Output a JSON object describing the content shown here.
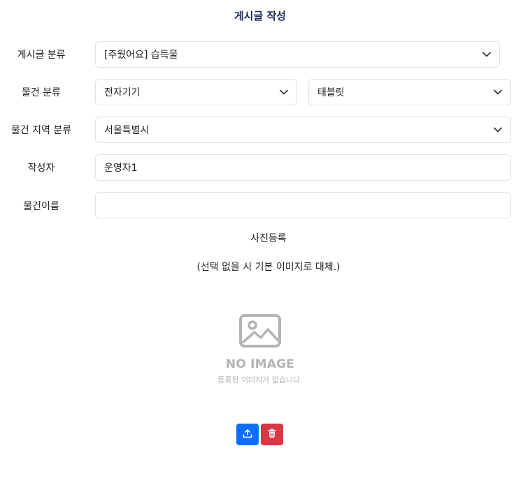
{
  "page": {
    "title": "게시글 작성"
  },
  "form": {
    "category": {
      "label": "게시글 분류",
      "value": "[주웠어요] 습득물"
    },
    "item_category": {
      "label": "물건 분류",
      "value": "전자기기",
      "sub_value": "태블릿"
    },
    "region": {
      "label": "물건 지역 분류",
      "value": "서울특별시"
    },
    "author": {
      "label": "작성자",
      "value": "운영자1"
    },
    "item_name": {
      "label": "물건이름",
      "value": "",
      "placeholder": ""
    }
  },
  "photo": {
    "heading": "사진등록",
    "note": "(선택 없을 시 기본 이미지로 대체.)",
    "no_image_title": "NO IMAGE",
    "no_image_sub": "등록된 이미지가 없습니다.",
    "icon": "image-placeholder-icon"
  },
  "buttons": {
    "upload_icon": "upload-icon",
    "delete_icon": "trash-icon",
    "upload_color": "#0d6efd",
    "delete_color": "#dc3545"
  }
}
